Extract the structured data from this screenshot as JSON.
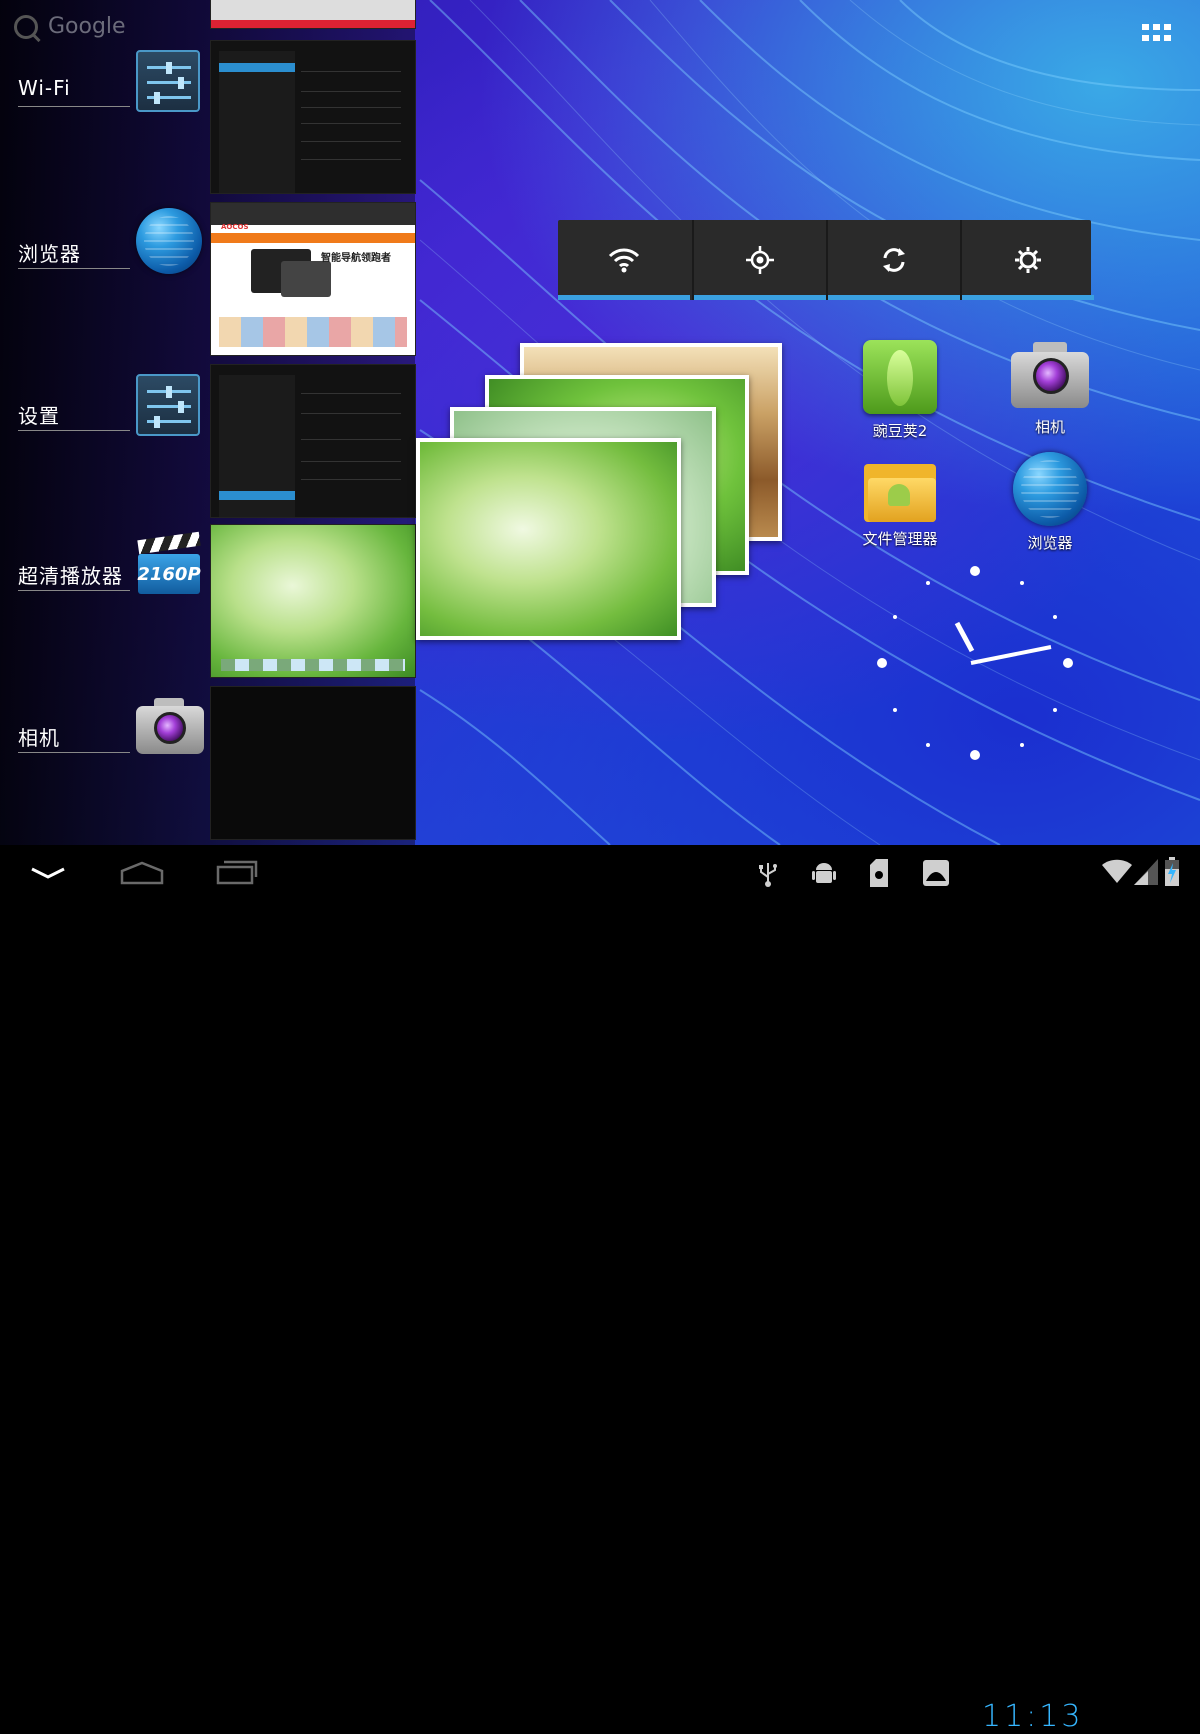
{
  "search": {
    "label": "Google"
  },
  "recents": [
    {
      "label": "Wi-Fi",
      "icon": "settings-icon",
      "thumb": "settings-screen"
    },
    {
      "label": "浏览器",
      "icon": "globe-icon",
      "thumb": "browser-page"
    },
    {
      "label": "设置",
      "icon": "settings-icon",
      "thumb": "settings-screen"
    },
    {
      "label": "超清播放器",
      "icon": "clapperboard-icon",
      "badge": "2160P",
      "thumb": "leaves-wallpaper"
    },
    {
      "label": "相机",
      "icon": "camera-icon",
      "thumb": "blank"
    }
  ],
  "browser_thumb": {
    "brand": "AOCOS",
    "headline": "智能导航领跑者"
  },
  "toggles": [
    "wifi-icon",
    "location-icon",
    "sync-icon",
    "brightness-icon"
  ],
  "home_apps": [
    {
      "label": "豌豆荚2",
      "icon": "peapod-icon"
    },
    {
      "label": "相机",
      "icon": "camera-icon"
    },
    {
      "label": "文件管理器",
      "icon": "folder-icon"
    },
    {
      "label": "浏览器",
      "icon": "globe-icon"
    }
  ],
  "status": {
    "time": "11:13"
  },
  "colors": {
    "accent": "#36b6ff",
    "toggle_underline": "#3aa0e0"
  }
}
